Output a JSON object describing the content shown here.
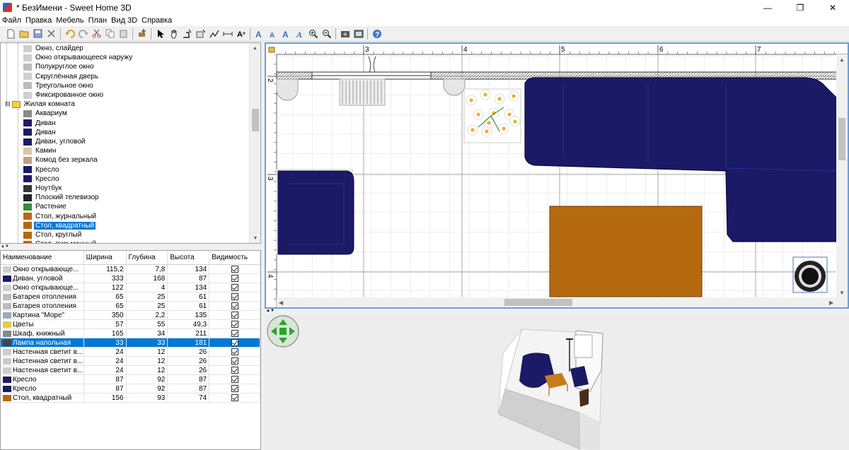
{
  "window": {
    "title": "* БезИмени - Sweet Home 3D",
    "minimize": "—",
    "maximize": "❐",
    "close": "✕"
  },
  "menu": [
    "Файл",
    "Правка",
    "Мебель",
    "План",
    "Вид 3D",
    "Справка"
  ],
  "toolbar_icons": [
    "new-file-icon",
    "open-icon",
    "save-icon",
    "cut-icon",
    "undo-icon",
    "redo-icon",
    "cut-icon",
    "copy-icon",
    "paste-icon",
    "add-furniture-icon",
    "select-icon",
    "pan-icon",
    "create-walls-icon",
    "create-rooms-icon",
    "create-polylines-icon",
    "create-dimensions-icon",
    "add-text-icon",
    "text-bigger-icon",
    "text-smaller-icon",
    "text-bold-icon",
    "text-italic-icon",
    "zoom-in-icon",
    "zoom-out-icon",
    "create-photo-icon",
    "create-video-icon",
    "help-icon"
  ],
  "catalog": {
    "items": [
      {
        "label": "Окно, слайдер",
        "level": 2,
        "icon": "window-icon"
      },
      {
        "label": "Окно открывающееся наружу",
        "level": 2,
        "icon": "window-icon"
      },
      {
        "label": "Полукруглое окно",
        "level": 2,
        "icon": "half-round-window-icon"
      },
      {
        "label": "Скруглённая дверь",
        "level": 2,
        "icon": "door-icon"
      },
      {
        "label": "Треугольное окно",
        "level": 2,
        "icon": "triangle-window-icon"
      },
      {
        "label": "Фиксированное окно",
        "level": 2,
        "icon": "window-icon"
      },
      {
        "label": "Жилая комната",
        "level": 1,
        "icon": "folder-icon",
        "expanded": true
      },
      {
        "label": "Аквариум",
        "level": 2,
        "icon": "aquarium-icon"
      },
      {
        "label": "Диван",
        "level": 2,
        "icon": "sofa-icon"
      },
      {
        "label": "Диван",
        "level": 2,
        "icon": "sofa-icon"
      },
      {
        "label": "Диван, угловой",
        "level": 2,
        "icon": "corner-sofa-icon"
      },
      {
        "label": "Камин",
        "level": 2,
        "icon": "fireplace-icon"
      },
      {
        "label": "Комод без зеркала",
        "level": 2,
        "icon": "chest-icon"
      },
      {
        "label": "Кресло",
        "level": 2,
        "icon": "armchair-icon"
      },
      {
        "label": "Кресло",
        "level": 2,
        "icon": "armchair-icon"
      },
      {
        "label": "Ноутбук",
        "level": 2,
        "icon": "laptop-icon"
      },
      {
        "label": "Плоский телевизор",
        "level": 2,
        "icon": "tv-icon"
      },
      {
        "label": "Растение",
        "level": 2,
        "icon": "plant-icon"
      },
      {
        "label": "Стол, журнальный",
        "level": 2,
        "icon": "table-icon"
      },
      {
        "label": "Стол, квадратный",
        "level": 2,
        "icon": "table-icon",
        "selected": true
      },
      {
        "label": "Стол, круглый",
        "level": 2,
        "icon": "round-table-icon"
      },
      {
        "label": "Стол, письменный",
        "level": 2,
        "icon": "desk-icon"
      }
    ]
  },
  "furniture_table": {
    "columns": [
      "Наименование",
      "Ширина",
      "Глубина",
      "Высота",
      "Видимость"
    ],
    "rows": [
      {
        "name": "Окно открывающе...",
        "w": "115,2",
        "d": "7,8",
        "h": "134",
        "icon": "window-icon"
      },
      {
        "name": "Диван, угловой",
        "w": "333",
        "d": "168",
        "h": "87",
        "icon": "corner-sofa-icon"
      },
      {
        "name": "Окно открывающе...",
        "w": "122",
        "d": "4",
        "h": "134",
        "icon": "window-icon"
      },
      {
        "name": "Батарея отопления",
        "w": "65",
        "d": "25",
        "h": "61",
        "icon": "radiator-icon"
      },
      {
        "name": "Батарея отопления",
        "w": "65",
        "d": "25",
        "h": "61",
        "icon": "radiator-icon"
      },
      {
        "name": "Картина \"Море\"",
        "w": "350",
        "d": "2,2",
        "h": "135",
        "icon": "picture-icon"
      },
      {
        "name": "Цветы",
        "w": "57",
        "d": "55",
        "h": "49,3",
        "icon": "flowers-icon"
      },
      {
        "name": "Шкаф, книжный",
        "w": "165",
        "d": "34",
        "h": "211",
        "icon": "bookcase-icon"
      },
      {
        "name": "Лампа напольная",
        "w": "33",
        "d": "33",
        "h": "181",
        "icon": "floor-lamp-icon",
        "selected": true
      },
      {
        "name": "Настенная светит в...",
        "w": "24",
        "d": "12",
        "h": "26",
        "icon": "wall-lamp-icon"
      },
      {
        "name": "Настенная светит в...",
        "w": "24",
        "d": "12",
        "h": "26",
        "icon": "wall-lamp-icon"
      },
      {
        "name": "Настенная светит в...",
        "w": "24",
        "d": "12",
        "h": "26",
        "icon": "wall-lamp-icon"
      },
      {
        "name": "Кресло",
        "w": "87",
        "d": "92",
        "h": "87",
        "icon": "armchair-icon"
      },
      {
        "name": "Кресло",
        "w": "87",
        "d": "92",
        "h": "87",
        "icon": "armchair-icon"
      },
      {
        "name": "Стол, квадратный",
        "w": "156",
        "d": "93",
        "h": "74",
        "icon": "table-icon"
      }
    ]
  },
  "plan": {
    "ruler_x": [
      "3",
      "4",
      "5",
      "6",
      "7"
    ],
    "ruler_y": [
      "2",
      "3",
      "4"
    ],
    "colors": {
      "sofa": "#1a1a66",
      "table": "#b5690f",
      "grid": "#cfcfcf",
      "border": "#6f9fd2"
    }
  }
}
